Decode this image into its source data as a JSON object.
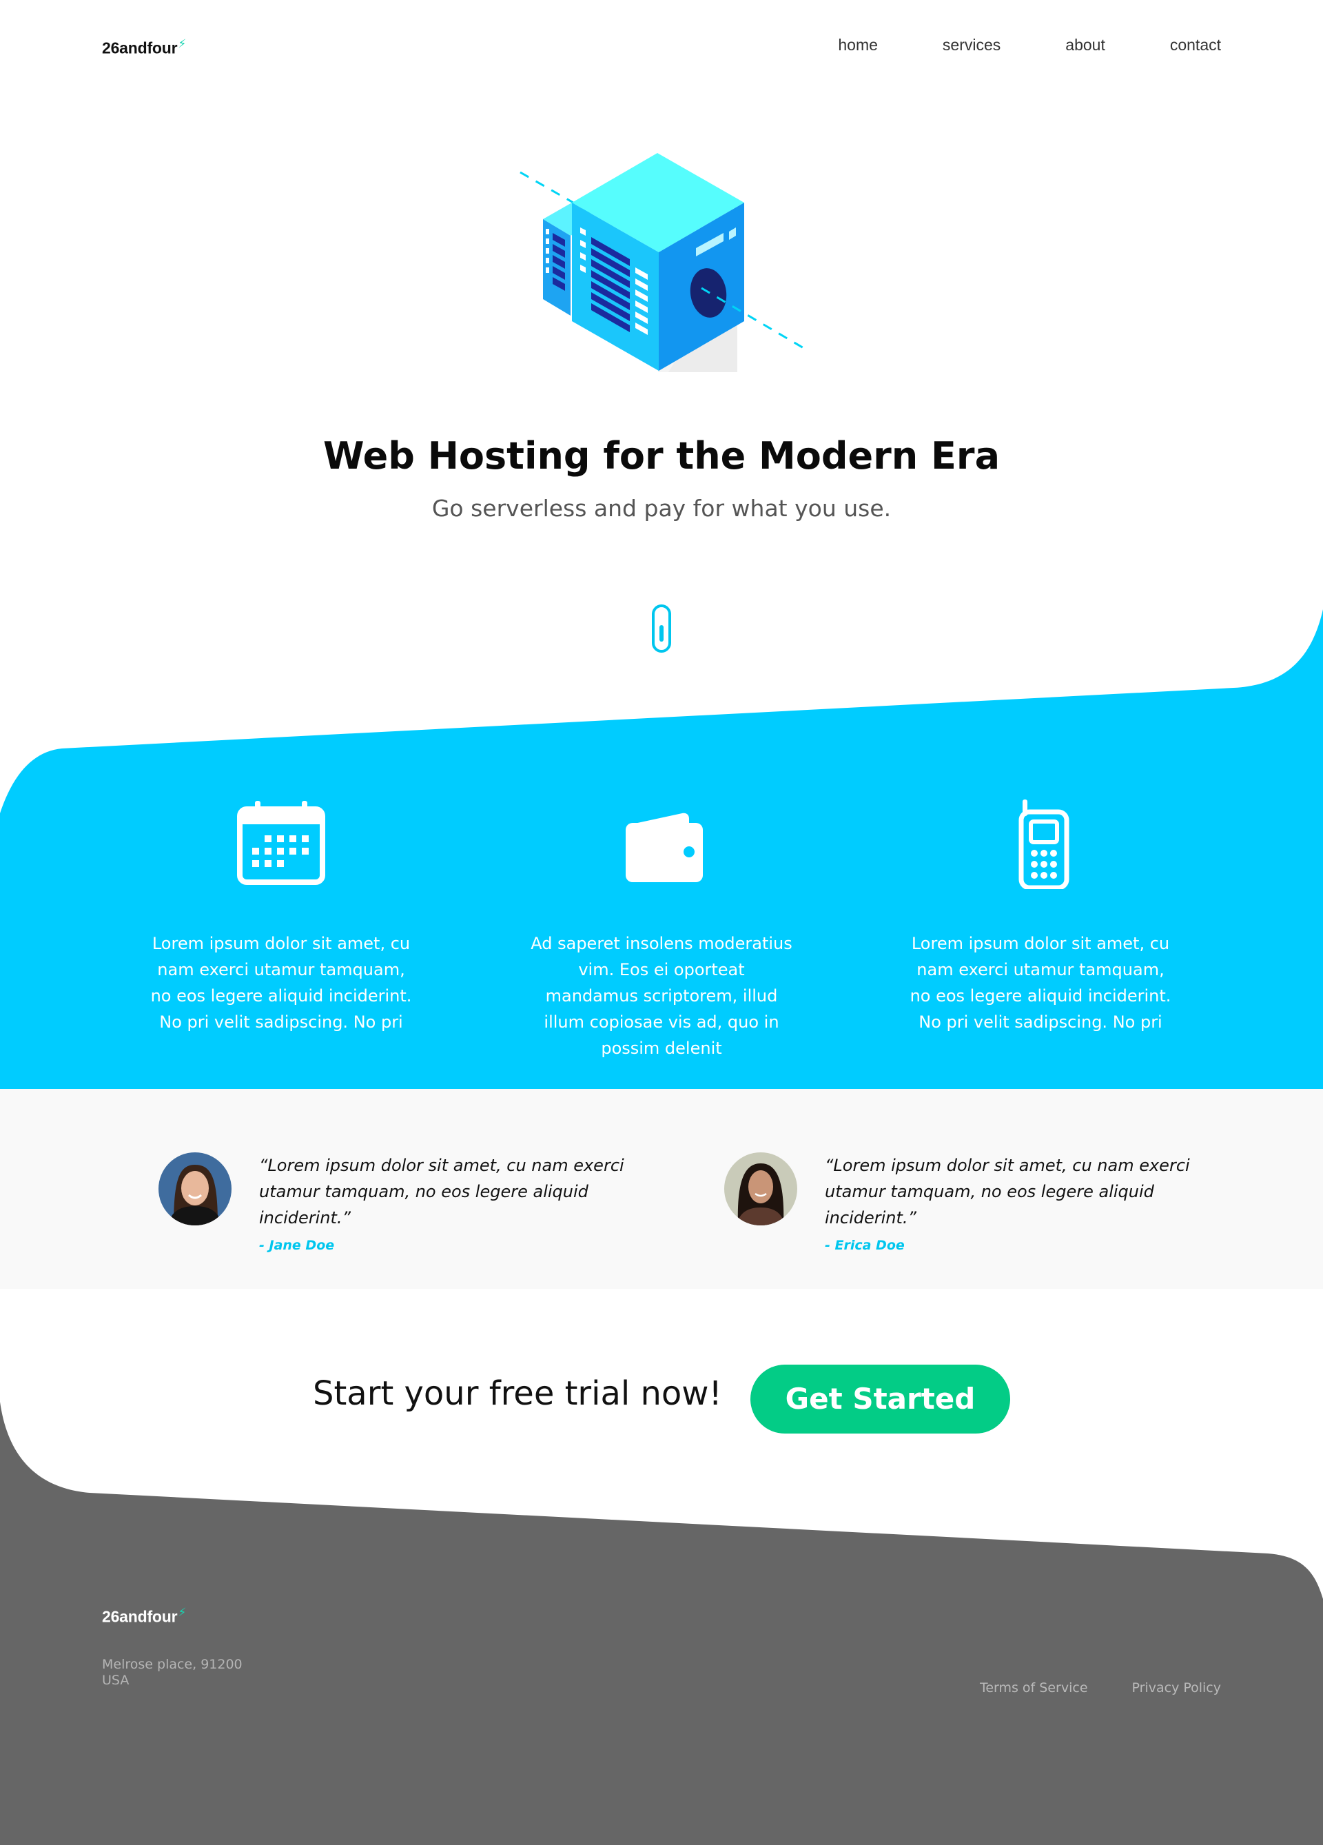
{
  "brand": {
    "name": "26andfour",
    "mark": "⚡"
  },
  "nav": {
    "items": [
      "home",
      "services",
      "about",
      "contact"
    ]
  },
  "hero": {
    "title": "Web Hosting for the Modern Era",
    "subtitle": "Go serverless and pay for what you use."
  },
  "features": [
    {
      "icon": "calendar-icon",
      "text": "Lorem ipsum dolor sit amet, cu nam exerci utamur tamquam, no eos legere aliquid inciderint. No pri velit sadipscing. No pri"
    },
    {
      "icon": "wallet-icon",
      "text": "Ad saperet insolens moderatius vim. Eos ei oporteat mandamus scriptorem, illud illum copiosae vis ad, quo in possim delenit"
    },
    {
      "icon": "mobile-phone-icon",
      "text": "Lorem ipsum dolor sit amet, cu nam exerci utamur tamquam, no eos legere aliquid inciderint. No pri velit sadipscing. No pri"
    }
  ],
  "testimonials": [
    {
      "quote": "“Lorem ipsum dolor sit amet, cu nam exerci utamur tamquam, no eos legere aliquid inciderint.”",
      "author": "- Jane Doe"
    },
    {
      "quote": "“Lorem ipsum dolor sit amet, cu nam exerci utamur tamquam, no eos legere aliquid inciderint.”",
      "author": "- Erica Doe"
    }
  ],
  "cta": {
    "text": "Start your free trial now!",
    "button": "Get Started"
  },
  "footer": {
    "address_line1": "Melrose place, 91200",
    "address_line2": "USA",
    "links": [
      "Terms of Service",
      "Privacy Policy"
    ]
  },
  "colors": {
    "accent": "#00CCFF",
    "cta": "#03CC86",
    "footer": "#666666",
    "testimonial_bg": "#F9F9F9"
  }
}
